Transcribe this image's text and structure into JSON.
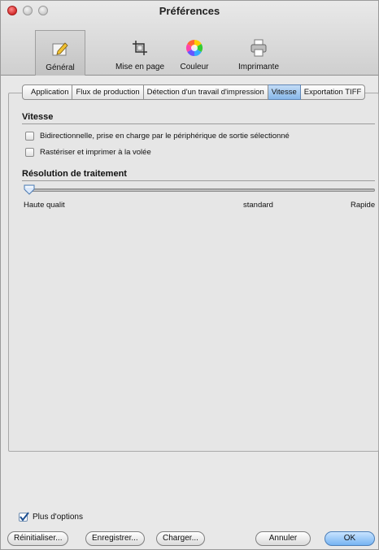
{
  "window": {
    "title": "Préférences"
  },
  "toolbar": {
    "items": [
      {
        "label": "Général",
        "icon": "edit-document-icon",
        "selected": true
      },
      {
        "label": "Mise en page",
        "icon": "crop-icon",
        "selected": false
      },
      {
        "label": "Couleur",
        "icon": "color-wheel-icon",
        "selected": false
      },
      {
        "label": "Imprimante",
        "icon": "printer-icon",
        "selected": false
      }
    ]
  },
  "tabs": [
    {
      "label": "Application",
      "active": false
    },
    {
      "label": "Flux de production",
      "active": false
    },
    {
      "label": "Détection d'un travail d'impression",
      "active": false
    },
    {
      "label": "Vitesse",
      "active": true
    },
    {
      "label": "Exportation TIFF",
      "active": false
    }
  ],
  "vitesse": {
    "title": "Vitesse",
    "options": [
      {
        "label": "Bidirectionnelle, prise en charge par le périphérique de sortie sélectionné",
        "checked": false
      },
      {
        "label": "Rastériser et imprimer à la volée",
        "checked": false
      }
    ]
  },
  "resolution": {
    "title": "Résolution de traitement",
    "labels": {
      "low": "Haute qualit",
      "mid": "standard",
      "high": "Rapide"
    },
    "value_fraction": 0.0
  },
  "footer": {
    "more_options": {
      "label": "Plus d'options",
      "checked": true
    },
    "buttons": {
      "reset": "Réinitialiser...",
      "save": "Enregistrer...",
      "load": "Charger...",
      "cancel": "Annuler",
      "ok": "OK"
    }
  },
  "colors": {
    "accent": "#76b3f2",
    "close": "#d22b2b"
  }
}
